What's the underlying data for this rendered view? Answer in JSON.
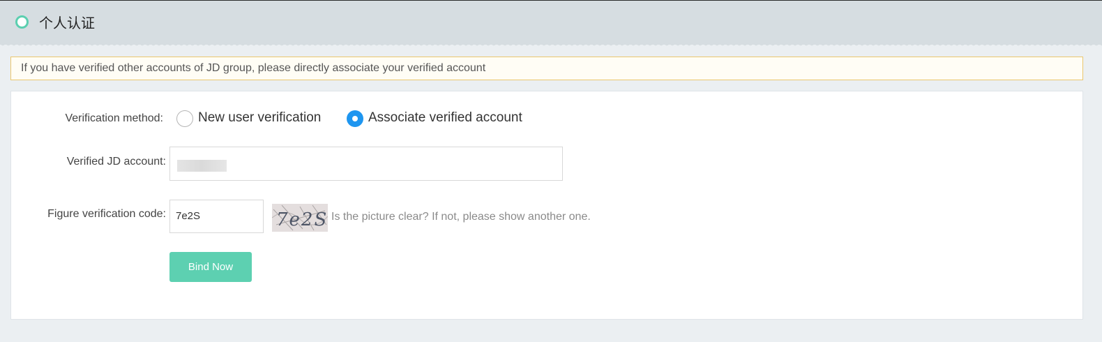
{
  "header": {
    "title": "个人认证",
    "icon": "ring-icon",
    "accent_color": "#5ccfb0"
  },
  "notice": {
    "text": "If you have verified other accounts of JD group, please directly associate your verified account"
  },
  "form": {
    "method_label": "Verification method:",
    "options": [
      {
        "label": "New user verification",
        "checked": false
      },
      {
        "label": "Associate verified account",
        "checked": true
      }
    ],
    "account_label": "Verified JD account:",
    "captcha_label": "Figure verification code:",
    "captcha_value": "7e2S",
    "captcha_image_text": "7e2S",
    "captcha_hint": "Is the picture clear? If not, please show another one.",
    "submit_label": "Bind Now"
  },
  "colors": {
    "primary_button": "#5dd0b1",
    "radio_checked": "#1e96f0",
    "notice_border": "#eac76e"
  }
}
